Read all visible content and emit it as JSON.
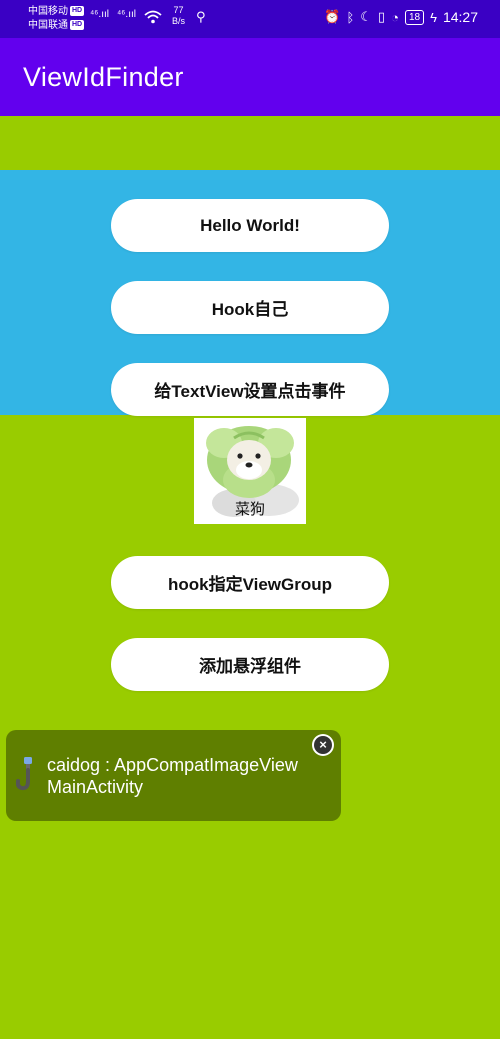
{
  "status_bar": {
    "carrier1": "中国移动",
    "carrier2": "中国联通",
    "hd_badge": "HD",
    "signal1": "⁴⁶.ııl",
    "signal2": "⁴⁶.ııl",
    "net_speed_value": "77",
    "net_speed_unit": "B/s",
    "battery": "18",
    "time": "14:27"
  },
  "app_bar": {
    "title": "ViewIdFinder"
  },
  "buttons": {
    "hello": "Hello World!",
    "hook_self": "Hook自己",
    "set_click": "给TextView设置点击事件",
    "hook_viewgroup": "hook指定ViewGroup",
    "add_floating": "添加悬浮组件"
  },
  "image": {
    "caption": "菜狗"
  },
  "floating_panel": {
    "line1": "caidog : AppCompatImageView",
    "line2": "MainActivity"
  },
  "colors": {
    "status_bar": "#3a00c4",
    "app_bar": "#6200ee",
    "background": "#99cc00",
    "blue_panel": "#33b5e5",
    "floating_panel": "#5f7f00"
  }
}
